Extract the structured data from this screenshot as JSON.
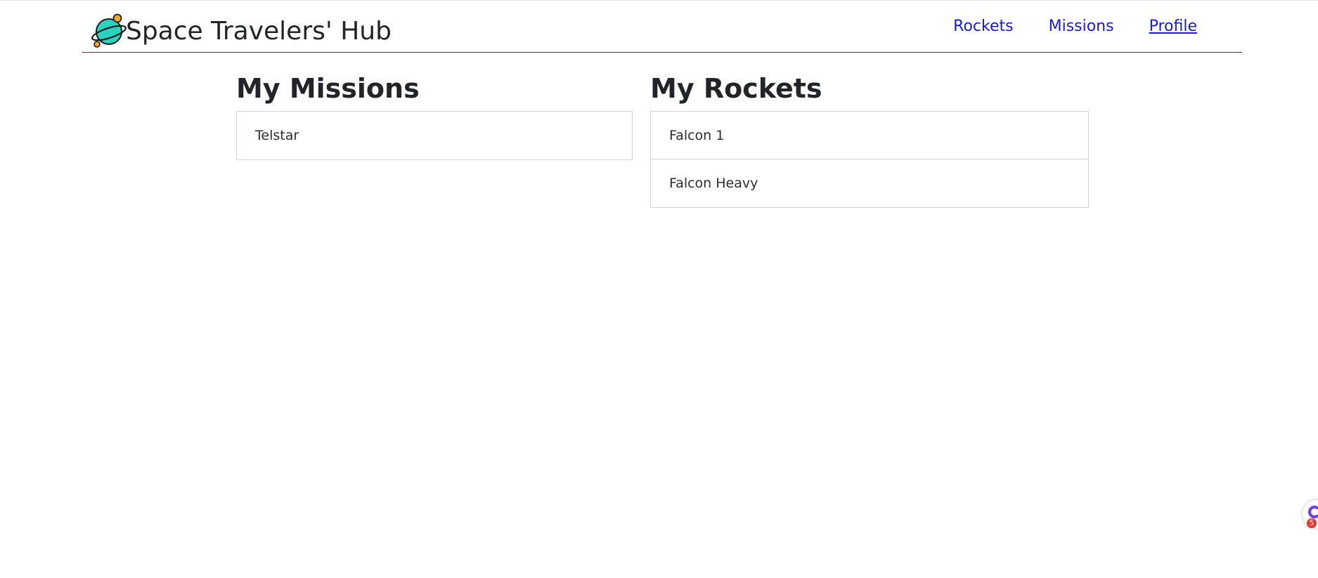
{
  "header": {
    "title": "Space Travelers' Hub",
    "logo_icon": "planet-icon",
    "nav": [
      {
        "label": "Rockets",
        "active": false
      },
      {
        "label": "Missions",
        "active": false
      },
      {
        "label": "Profile",
        "active": true
      }
    ]
  },
  "missions": {
    "heading": "My Missions",
    "items": [
      "Telstar"
    ]
  },
  "rockets": {
    "heading": "My Rockets",
    "items": [
      "Falcon 1",
      "Falcon Heavy"
    ]
  },
  "widget": {
    "icon": "assistant-icon",
    "badge_count": "5"
  },
  "colors": {
    "link": "#1a1adb",
    "planet": "#2ad3c0",
    "moon": "#f5a623",
    "badge": "#e8342a"
  }
}
